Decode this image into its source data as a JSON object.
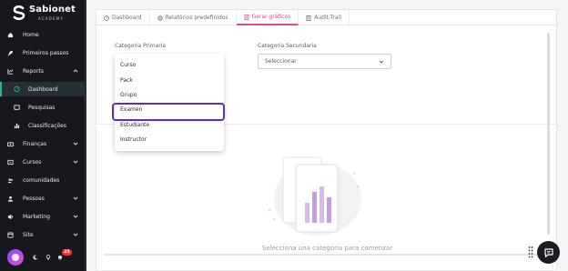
{
  "brand": {
    "name": "Sabionet",
    "sub": "ACADEMY"
  },
  "sidebar": {
    "items": [
      {
        "label": "Home",
        "icon": "home-icon"
      },
      {
        "label": "Primeiros passos",
        "icon": "rocket-icon"
      },
      {
        "label": "Reports",
        "icon": "chart-icon",
        "expanded": true
      },
      {
        "label": "Dashboard",
        "icon": "dashboard-icon",
        "active": true
      },
      {
        "label": "Pesquisas",
        "icon": "survey-icon"
      },
      {
        "label": "Classificações",
        "icon": "ranking-icon"
      },
      {
        "label": "Finanças",
        "icon": "finance-icon"
      },
      {
        "label": "Cursos",
        "icon": "courses-icon"
      },
      {
        "label": "comunidades",
        "icon": "community-icon"
      },
      {
        "label": "Pessoas",
        "icon": "people-icon"
      },
      {
        "label": "Marketing",
        "icon": "megaphone-icon"
      },
      {
        "label": "Site",
        "icon": "site-icon"
      }
    ],
    "notification_count": "25",
    "accent_color": "#1fb6a8"
  },
  "tabs": [
    {
      "label": "Dashboard",
      "icon": "gauge-icon"
    },
    {
      "label": "Relatórios predefinidos",
      "icon": "gear-icon"
    },
    {
      "label": "Gerar gráficos",
      "icon": "document-icon",
      "active": true
    },
    {
      "label": "Audit-Trail",
      "icon": "audit-icon"
    }
  ],
  "form": {
    "primary_label": "Categoria Primaria",
    "secondary_label": "Categoria Secundaria",
    "secondary_value": "Seleccionar"
  },
  "dropdown_options": [
    "Curso",
    "Pack",
    "Grupo",
    "Examen",
    "Estudiante",
    "Instructor"
  ],
  "highlighted_option": "Examen",
  "empty_state": "Selecciona una categoria para comenzar",
  "colors": {
    "active_tab": "#e04b8a",
    "highlight": "#5a2bd8",
    "sidebar_bg": "#16181d"
  }
}
